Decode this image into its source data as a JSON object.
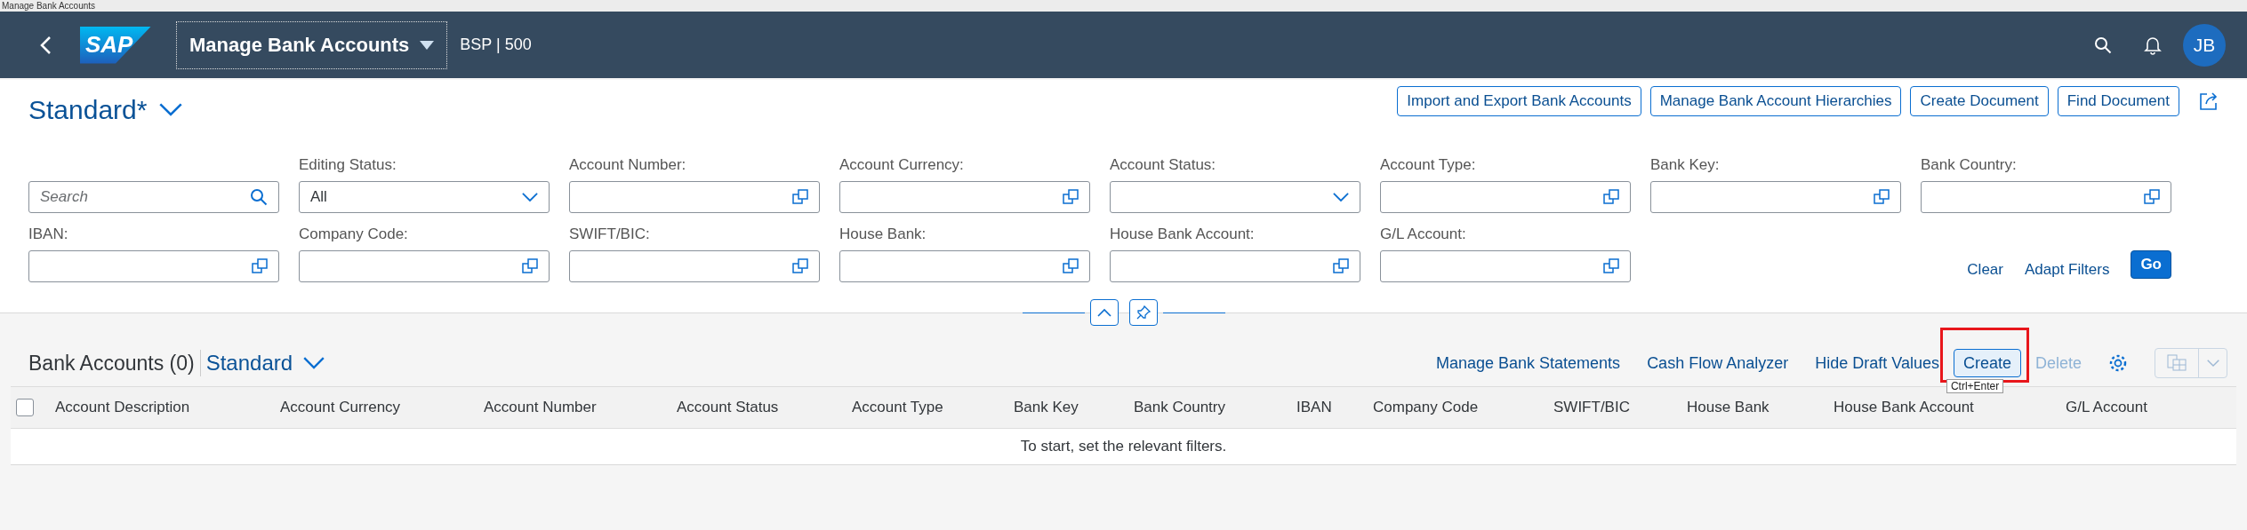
{
  "browser_tab": {
    "title": "Manage Bank Accounts"
  },
  "shell": {
    "logo": "SAP",
    "app_title": "Manage Bank Accounts",
    "system": "BSP | 500",
    "avatar": "JB"
  },
  "header": {
    "variant": "Standard*",
    "buttons": [
      "Import and Export Bank Accounts",
      "Manage Bank Account Hierarchies",
      "Create Document",
      "Find Document"
    ]
  },
  "filters": [
    {
      "kind": "search",
      "placeholder": "Search"
    },
    {
      "kind": "select",
      "label": "Editing Status:",
      "value": "All"
    },
    {
      "kind": "valuehelp",
      "label": "Account Number:"
    },
    {
      "kind": "valuehelp",
      "label": "Account Currency:"
    },
    {
      "kind": "select",
      "label": "Account Status:"
    },
    {
      "kind": "valuehelp",
      "label": "Account Type:"
    },
    {
      "kind": "valuehelp",
      "label": "Bank Key:"
    },
    {
      "kind": "valuehelp",
      "label": "Bank Country:"
    },
    {
      "kind": "valuehelp",
      "label": "IBAN:"
    },
    {
      "kind": "valuehelp",
      "label": "Company Code:"
    },
    {
      "kind": "valuehelp",
      "label": "SWIFT/BIC:"
    },
    {
      "kind": "valuehelp",
      "label": "House Bank:"
    },
    {
      "kind": "valuehelp",
      "label": "House Bank Account:"
    },
    {
      "kind": "valuehelp",
      "label": "G/L Account:"
    }
  ],
  "filter_actions": {
    "clear": "Clear",
    "adapt": "Adapt Filters",
    "go": "Go"
  },
  "table": {
    "title": "Bank Accounts (0)",
    "variant": "Standard",
    "actions": [
      {
        "kind": "link",
        "label": "Manage Bank Statements",
        "disabled": false
      },
      {
        "kind": "link",
        "label": "Cash Flow Analyzer",
        "disabled": false
      },
      {
        "kind": "link",
        "label": "Hide Draft Values",
        "disabled": false
      },
      {
        "kind": "button",
        "label": "Create",
        "disabled": false,
        "highlighted": true,
        "tooltip": "Ctrl+Enter"
      },
      {
        "kind": "link",
        "label": "Delete",
        "disabled": true
      }
    ],
    "select_all": {
      "checked": false
    },
    "columns": [
      "Account Description",
      "Account Currency",
      "Account Number",
      "Account Status",
      "Account Type",
      "Bank Key",
      "Bank Country",
      "IBAN",
      "Company Code",
      "SWIFT/BIC",
      "House Bank",
      "House Bank Account",
      "G/L Account"
    ],
    "empty_text": "To start, set the relevant filters."
  }
}
